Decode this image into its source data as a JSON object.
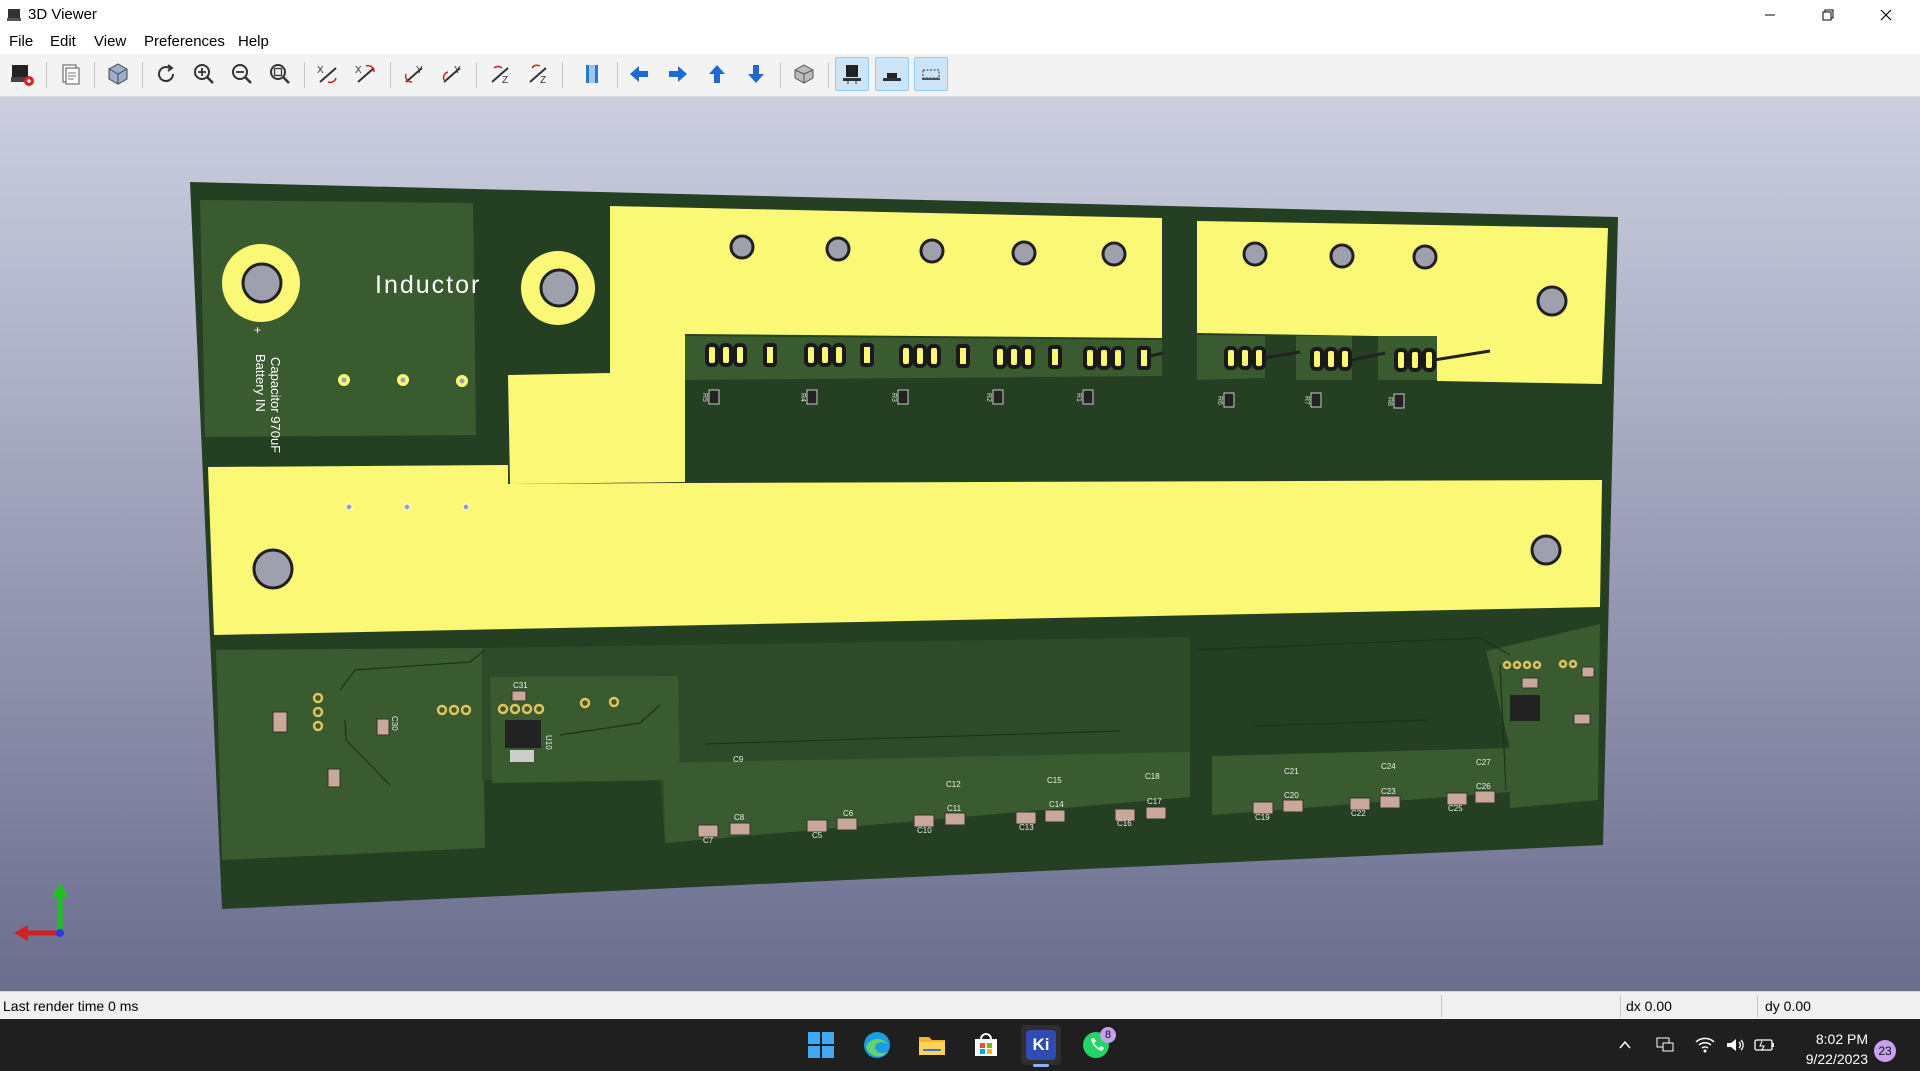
{
  "window": {
    "title": "3D Viewer",
    "icon": "kicad-3d-viewer-icon",
    "controls": [
      "minimize-icon",
      "restore-icon",
      "close-icon"
    ]
  },
  "menu": [
    "File",
    "Edit",
    "View",
    "Preferences",
    "Help"
  ],
  "toolbar": [
    {
      "name": "reload-board-icon"
    },
    {
      "name": "copy-3d-image-icon"
    },
    {
      "name": "render-options-icon"
    },
    {
      "name": "redraw-icon"
    },
    {
      "name": "zoom-in-icon"
    },
    {
      "name": "zoom-out-icon"
    },
    {
      "name": "zoom-fit-icon"
    },
    {
      "name": "rotate-x-cw-icon"
    },
    {
      "name": "rotate-x-ccw-icon"
    },
    {
      "name": "rotate-y-cw-icon"
    },
    {
      "name": "rotate-y-ccw-icon"
    },
    {
      "name": "rotate-z-cw-icon"
    },
    {
      "name": "rotate-z-ccw-icon"
    },
    {
      "name": "flip-board-icon"
    },
    {
      "name": "pan-left-icon"
    },
    {
      "name": "pan-right-icon"
    },
    {
      "name": "pan-up-icon"
    },
    {
      "name": "pan-down-icon"
    },
    {
      "name": "ortho-toggle-icon"
    },
    {
      "name": "show-tht-icon",
      "active": true
    },
    {
      "name": "show-smd-icon",
      "active": true
    },
    {
      "name": "show-virtual-icon",
      "active": true
    }
  ],
  "pcb": {
    "silkscreen": {
      "inductor": "Inductor",
      "capacitor": "Capacitor 970uF",
      "battery": "Battery IN",
      "plus": "+"
    },
    "refs_top": [
      "R5",
      "R4",
      "R3",
      "R2",
      "R1",
      "R6",
      "R7",
      "R8"
    ],
    "refs_bottom": [
      "C31",
      "U10",
      "C30",
      "C9",
      "C8",
      "C7",
      "C6",
      "C5",
      "C12",
      "C11",
      "C10",
      "C15",
      "C14",
      "C13",
      "C18",
      "C17",
      "C16",
      "C21",
      "C20",
      "C19",
      "C24",
      "C23",
      "C22",
      "C27",
      "C26",
      "C25"
    ],
    "colors": {
      "board": "#243f22",
      "copper_zone": "#fbf876",
      "mask_zone": "#3a5a30",
      "hole": "#9fa0ae"
    }
  },
  "axes": {
    "x": "red",
    "y": "green"
  },
  "status": {
    "render_time": "Last render time 0 ms",
    "dx": "dx 0.00",
    "dy": "dy 0.00"
  },
  "taskbar": {
    "apps": [
      {
        "name": "windows-start-icon"
      },
      {
        "name": "edge-browser-icon"
      },
      {
        "name": "file-explorer-icon"
      },
      {
        "name": "microsoft-store-icon"
      },
      {
        "name": "kicad-app-icon",
        "label": "Ki"
      },
      {
        "name": "whatsapp-icon",
        "badge": "8"
      }
    ],
    "tray": [
      "chevron-up-icon",
      "network-icon",
      "wifi-icon",
      "speaker-icon",
      "battery-icon"
    ],
    "time": "8:02 PM",
    "date": "9/22/2023",
    "notifications": "23"
  }
}
